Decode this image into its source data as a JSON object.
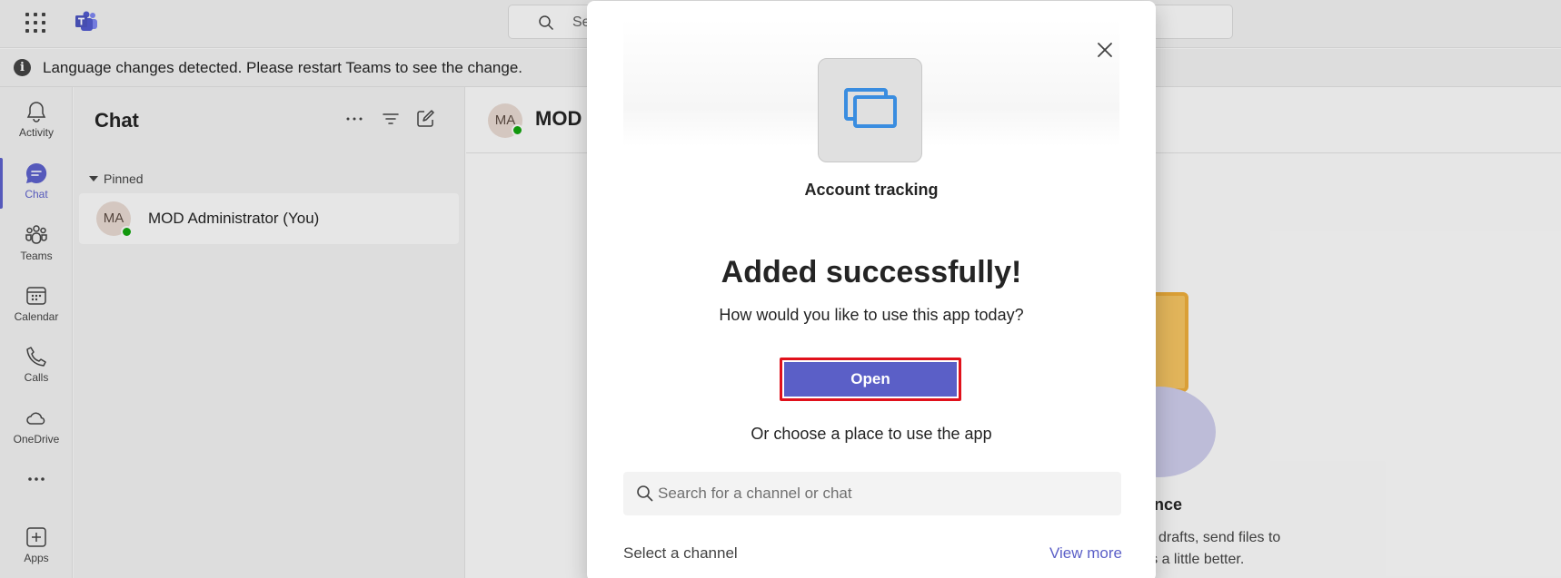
{
  "topbar": {
    "search_placeholder": "Se"
  },
  "banner": {
    "icon": "info-icon",
    "icon_glyph": "i",
    "text": "Language changes detected. Please restart Teams to see the change."
  },
  "rail": {
    "items": [
      {
        "label": "Activity",
        "icon": "bell-icon"
      },
      {
        "label": "Chat",
        "icon": "chat-icon",
        "active": true
      },
      {
        "label": "Teams",
        "icon": "teams-icon"
      },
      {
        "label": "Calendar",
        "icon": "calendar-icon"
      },
      {
        "label": "Calls",
        "icon": "phone-icon"
      },
      {
        "label": "OneDrive",
        "icon": "cloud-icon"
      },
      {
        "label": "",
        "icon": "more-icon"
      },
      {
        "label": "Apps",
        "icon": "add-apps-icon"
      }
    ]
  },
  "chatlist": {
    "title": "Chat",
    "section": "Pinned",
    "rows": [
      {
        "initials": "MA",
        "name": "MOD Administrator (You)",
        "status": "available"
      }
    ]
  },
  "main": {
    "header": {
      "initials": "MA",
      "name": "MOD"
    },
    "empty_title": "nce",
    "empty_sub_line1": "t for drafts, send files to",
    "empty_sub_line2": "ures a little better."
  },
  "dialog": {
    "app_name": "Account tracking",
    "title": "Added successfully!",
    "question": "How would you like to use this app today?",
    "open_label": "Open",
    "or_choose": "Or choose a place to use the app",
    "search_placeholder": "Search for a channel or chat",
    "select_label": "Select a channel",
    "view_more": "View more"
  },
  "colors": {
    "brand": "#5b5fc7",
    "highlight_border": "#e0111b",
    "presence": "#13a10e"
  }
}
